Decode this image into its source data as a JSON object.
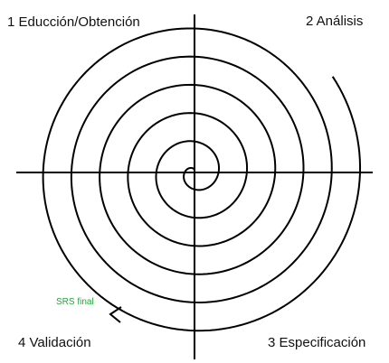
{
  "phases": {
    "top_left": "1 Educción/Obtención",
    "top_right": "2 Análisis",
    "bottom_right": "3 Especificación",
    "bottom_left": "4 Validación"
  },
  "output": {
    "label": "SRS final",
    "color": "#21a83a"
  },
  "colors": {
    "line": "#000000",
    "text": "#111111",
    "background": "#ffffff"
  }
}
